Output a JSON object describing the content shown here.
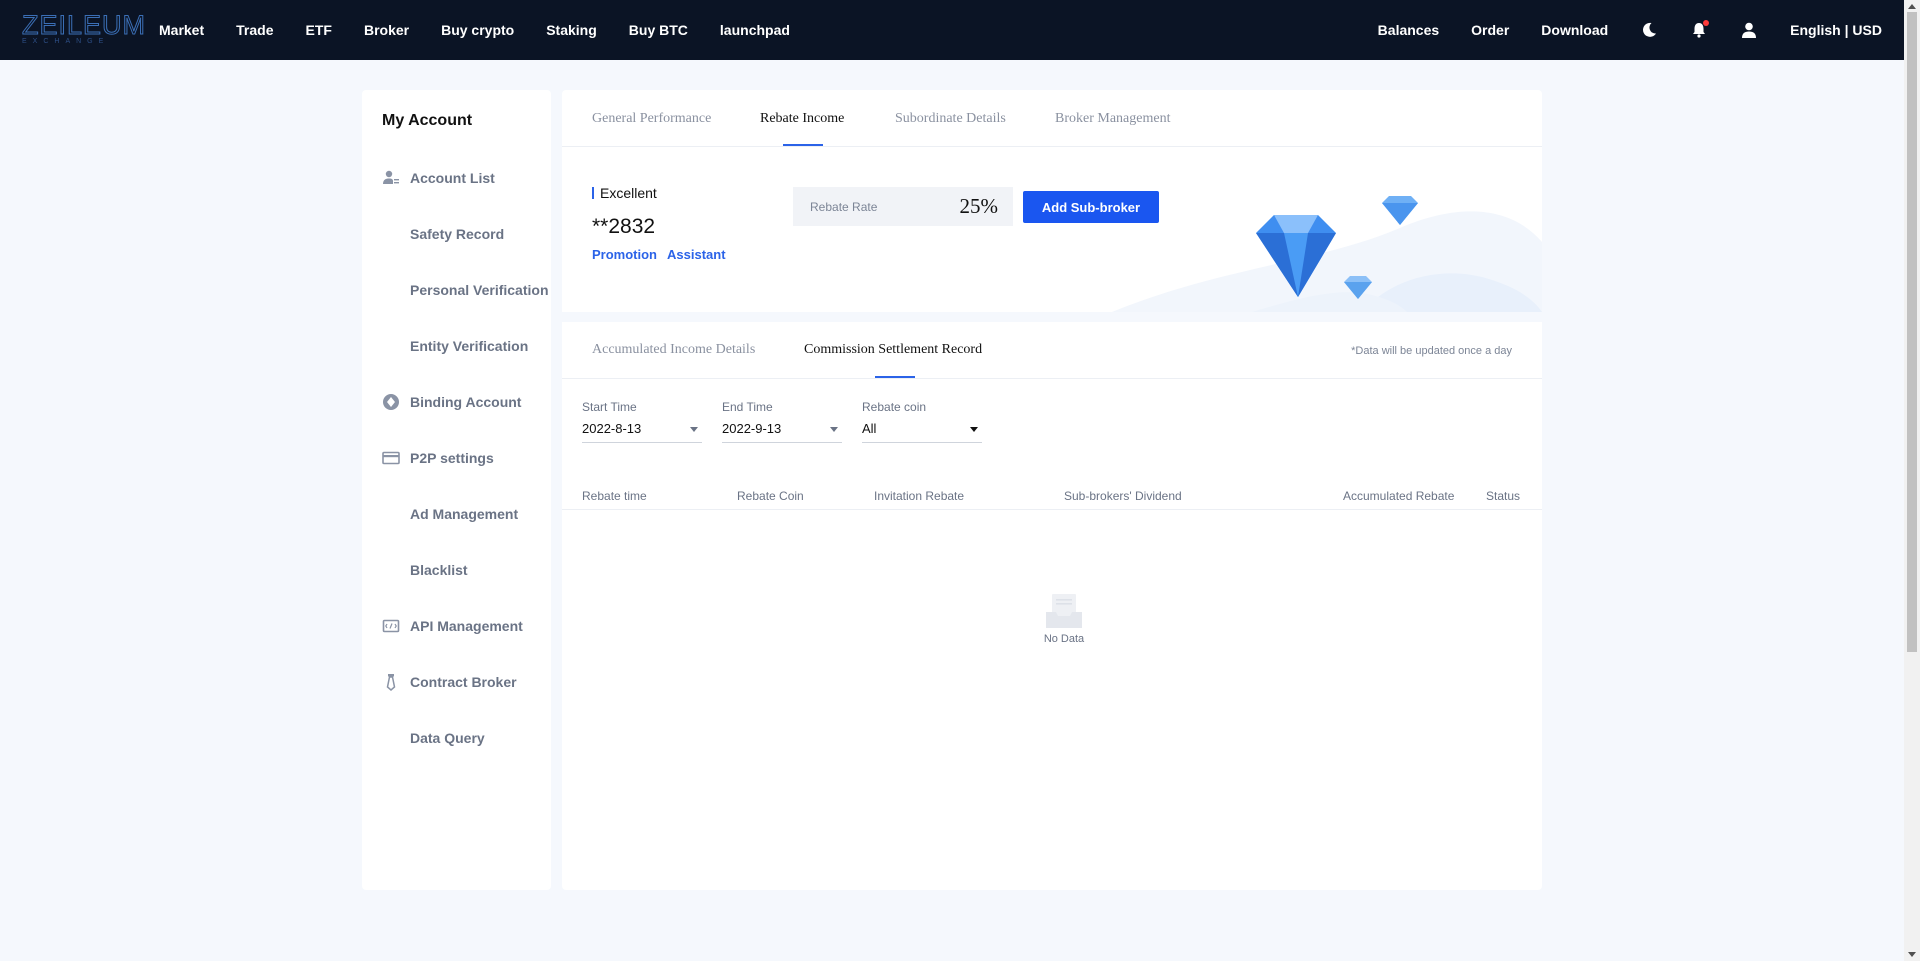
{
  "brand": {
    "name": "ZEILEUM",
    "sub": "EXCHANGE"
  },
  "nav": {
    "left": [
      "Market",
      "Trade",
      "ETF",
      "Broker",
      "Buy crypto",
      "Staking",
      "Buy BTC",
      "launchpad"
    ],
    "right": [
      "Balances",
      "Order",
      "Download"
    ],
    "language": "English | USD"
  },
  "sidebar": {
    "title": "My Account",
    "items": [
      {
        "label": "Account List",
        "icon": "user-list-icon"
      },
      {
        "label": "Safety Record",
        "icon": ""
      },
      {
        "label": "Personal Verification",
        "icon": ""
      },
      {
        "label": "Entity Verification",
        "icon": ""
      },
      {
        "label": "Binding Account",
        "icon": "binding-icon"
      },
      {
        "label": "P2P settings",
        "icon": "card-icon"
      },
      {
        "label": "Ad Management",
        "icon": ""
      },
      {
        "label": "Blacklist",
        "icon": ""
      },
      {
        "label": "API Management",
        "icon": "api-icon"
      },
      {
        "label": "Contract Broker",
        "icon": "tie-icon"
      },
      {
        "label": "Data Query",
        "icon": ""
      }
    ]
  },
  "tabs": [
    "General Performance",
    "Rebate Income",
    "Subordinate Details",
    "Broker Management"
  ],
  "active_tab": "Rebate Income",
  "hero": {
    "level": "Excellent",
    "uid": "**2832",
    "links": [
      "Promotion",
      "Assistant"
    ],
    "rebate_rate_label": "Rebate Rate",
    "rebate_rate_value": "25%",
    "add_button": "Add Sub-broker"
  },
  "subtabs": [
    "Accumulated Income Details",
    "Commission Settlement Record"
  ],
  "active_subtab": "Commission Settlement Record",
  "note": "*Data will be updated once a day",
  "filters": {
    "start": {
      "label": "Start Time",
      "value": "2022-8-13"
    },
    "end": {
      "label": "End Time",
      "value": "2022-9-13"
    },
    "coin": {
      "label": "Rebate coin",
      "value": "All"
    }
  },
  "table": {
    "columns": [
      "Rebate time",
      "Rebate Coin",
      "Invitation Rebate",
      "Sub-brokers' Dividend",
      "Accumulated Rebate",
      "Status"
    ],
    "empty_text": "No Data"
  },
  "colors": {
    "accent": "#1a56f0",
    "nav_bg": "#0b1425",
    "page_bg": "#f5f8fd"
  }
}
